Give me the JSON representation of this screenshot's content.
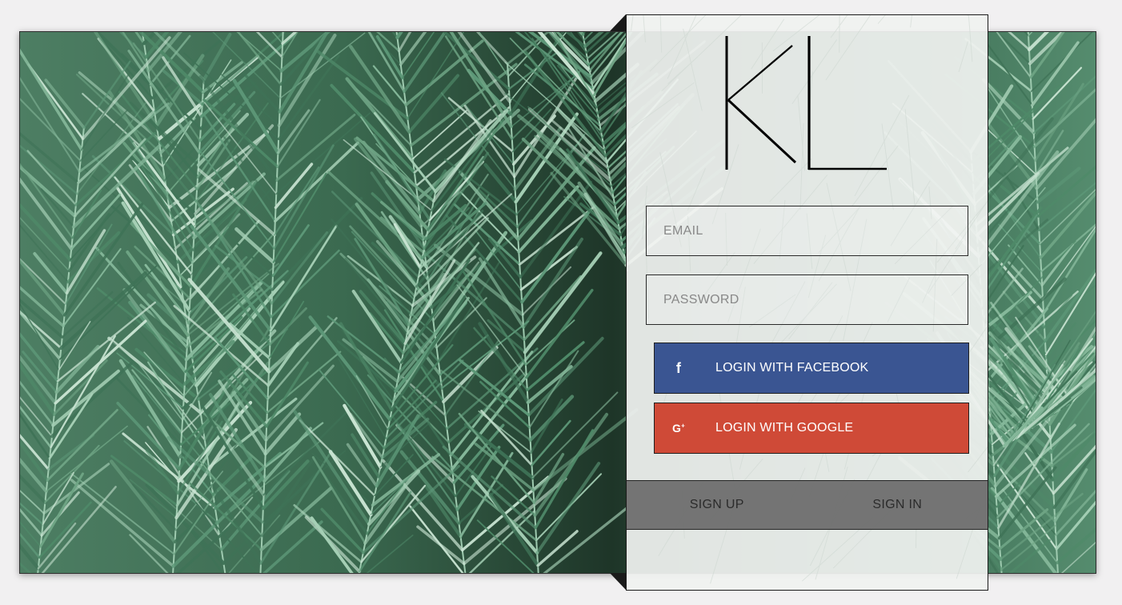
{
  "logo": {
    "text": "KL"
  },
  "form": {
    "email_placeholder": "EMAIL",
    "password_placeholder": "PASSWORD"
  },
  "social": {
    "facebook_label": "LOGIN WITH FACEBOOK",
    "facebook_icon": "facebook-icon",
    "facebook_color": "#3a5592",
    "google_label": "LOGIN WITH GOOGLE",
    "google_icon": "google-plus-icon",
    "google_color": "#cf4a37"
  },
  "tabs": {
    "signup_label": "SIGN UP",
    "signin_label": "SIGN IN"
  },
  "colors": {
    "page_background": "#f1f0f1",
    "foliage": "#2f4d3c"
  }
}
